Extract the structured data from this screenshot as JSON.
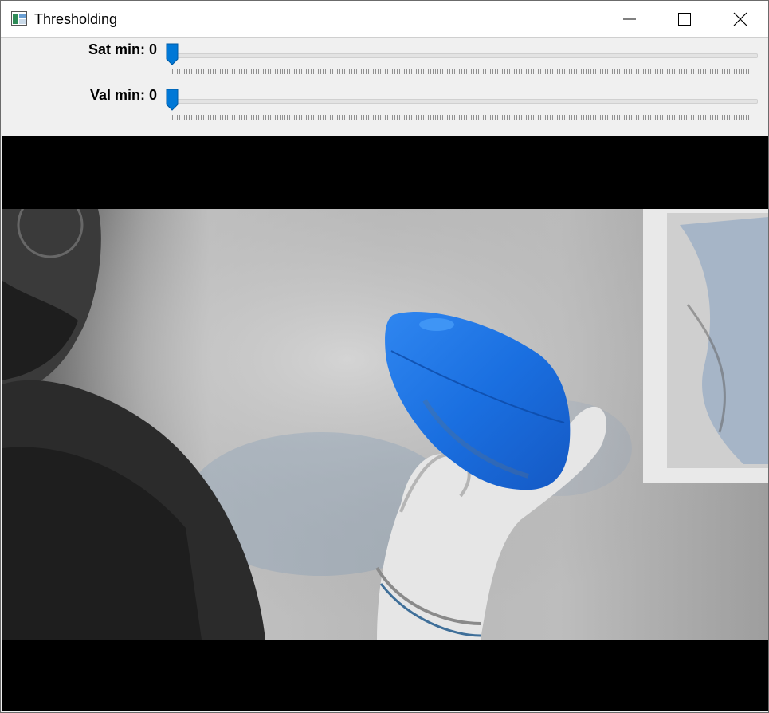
{
  "window": {
    "title": "Thresholding",
    "icons": {
      "app": "app-window-icon",
      "minimize": "minimize-icon",
      "maximize": "maximize-icon",
      "close": "close-icon"
    }
  },
  "trackbars": [
    {
      "label": "Sat min: 0",
      "value": 0,
      "max": 255
    },
    {
      "label": "Val min: 0",
      "value": 0,
      "max": 255
    }
  ],
  "colors": {
    "accent": "#0078d7",
    "highlight_blue": "#1a73e8",
    "image_background": "#000000"
  }
}
